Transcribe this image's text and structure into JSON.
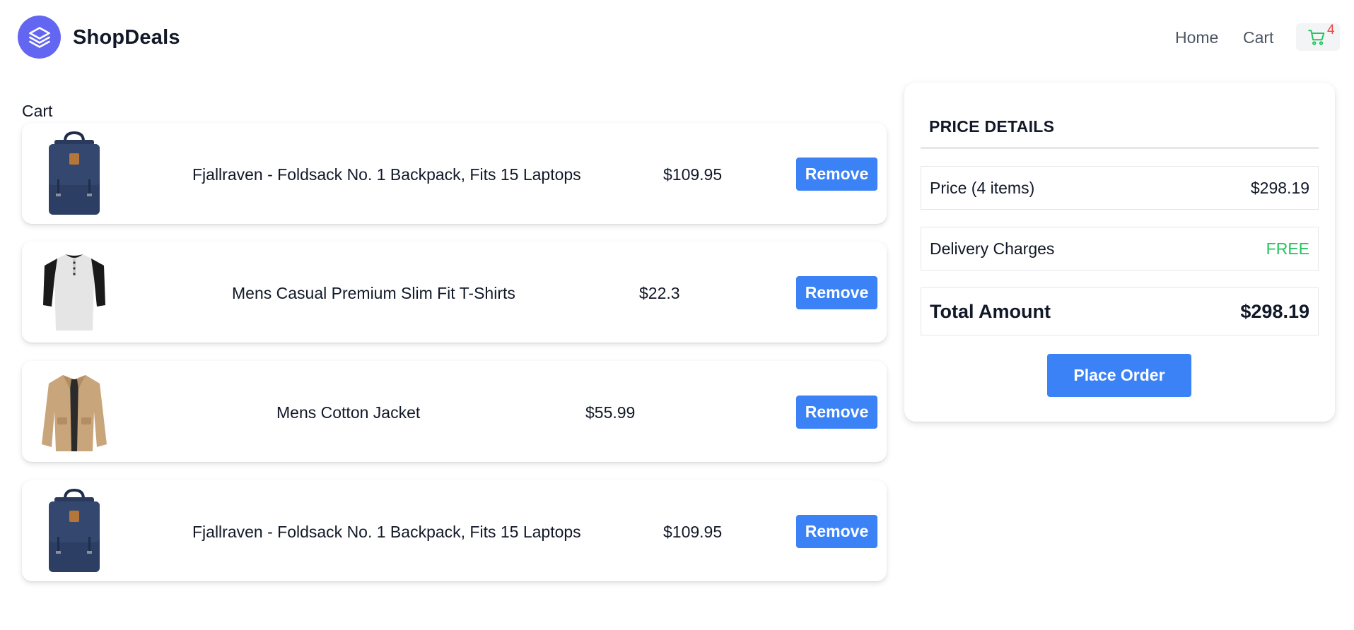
{
  "header": {
    "brand": "ShopDeals",
    "nav": {
      "home": "Home",
      "cart": "Cart"
    },
    "cart_count": "4"
  },
  "cart": {
    "heading": "Cart",
    "remove_label": "Remove",
    "items": [
      {
        "title": "Fjallraven - Foldsack No. 1 Backpack, Fits 15 Laptops",
        "price": "$109.95",
        "image": "backpack"
      },
      {
        "title": "Mens Casual Premium Slim Fit T-Shirts",
        "price": "$22.3",
        "image": "t-shirt"
      },
      {
        "title": "Mens Cotton Jacket",
        "price": "$55.99",
        "image": "jacket"
      },
      {
        "title": "Fjallraven - Foldsack No. 1 Backpack, Fits 15 Laptops",
        "price": "$109.95",
        "image": "backpack"
      }
    ]
  },
  "price_details": {
    "title": "PRICE DETAILS",
    "price_label": "Price (4 items)",
    "price_value": "$298.19",
    "delivery_label": "Delivery Charges",
    "delivery_value": "FREE",
    "total_label": "Total Amount",
    "total_value": "$298.19",
    "place_order_label": "Place Order"
  },
  "colors": {
    "brand": "#6366f1",
    "button": "#3b82f6",
    "free": "#22c55e",
    "badge": "#ef4444"
  }
}
